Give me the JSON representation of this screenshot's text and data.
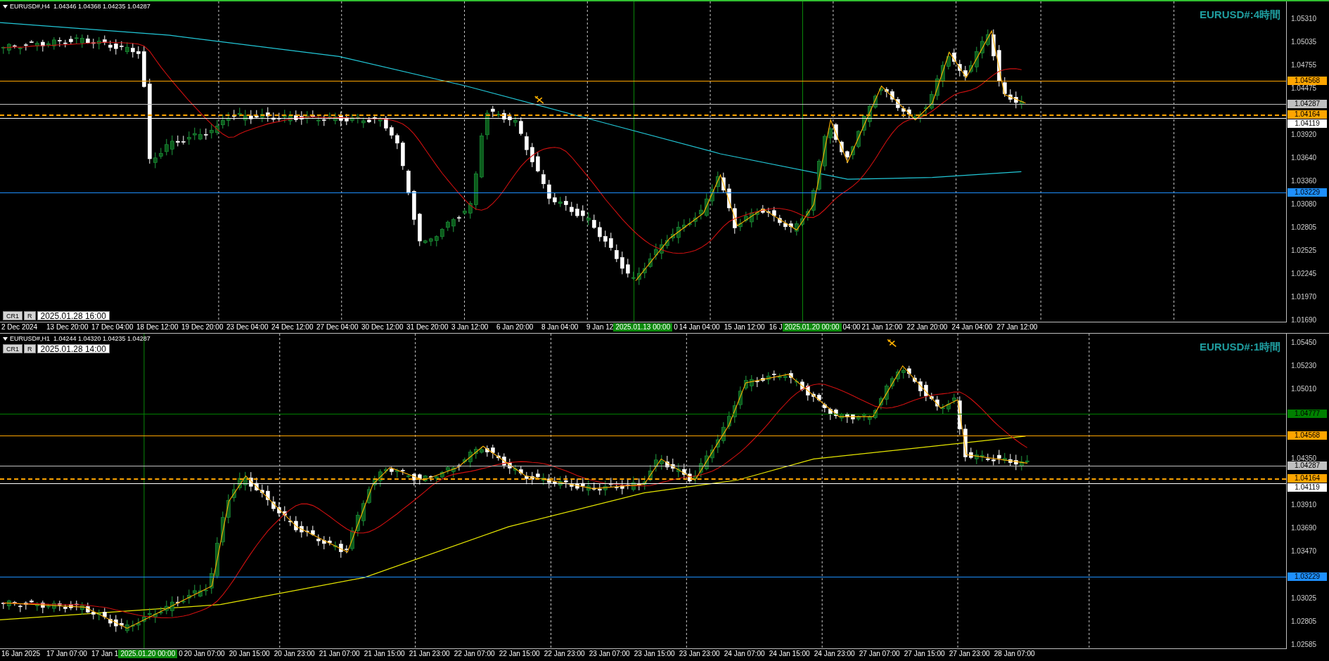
{
  "charts": [
    {
      "header": "EURUSD#,H4  1.04346 1.04368 1.04235 1.04287",
      "title": "EURUSD#:4時間",
      "cursor": {
        "buttons": [
          "CR1",
          "R"
        ],
        "time": "2025.01.28 16:00"
      },
      "price_ticks": [
        "1.05310",
        "1.05035",
        "1.04755",
        "1.04475",
        "1.03920",
        "1.03640",
        "1.03360",
        "1.03080",
        "1.02805",
        "1.02525",
        "1.02245",
        "1.01970",
        "1.01690"
      ],
      "price_lines": [
        {
          "price": "1.04568",
          "color": "#ffa500",
          "dashed": false
        },
        {
          "price": "1.04287",
          "color": "#c0c0c0",
          "dashed": false
        },
        {
          "price": "1.04164",
          "color": "#ffa500",
          "dashed": true
        },
        {
          "price": "1.04119",
          "color": "#ffffff",
          "dashed": false
        },
        {
          "price": "1.03229",
          "color": "#1e90ff",
          "dashed": false
        }
      ],
      "time_axis": [
        {
          "kind": "label",
          "text": "2 Dec 2024"
        },
        {
          "kind": "label",
          "text": "13 Dec 20:00"
        },
        {
          "kind": "label",
          "text": "17 Dec 04:00"
        },
        {
          "kind": "label",
          "text": "18 Dec 12:00"
        },
        {
          "kind": "label",
          "text": "19 Dec 20:00"
        },
        {
          "kind": "label",
          "text": "23 Dec 04:00"
        },
        {
          "kind": "label",
          "text": "24 Dec 12:00"
        },
        {
          "kind": "label",
          "text": "27 Dec 04:00"
        },
        {
          "kind": "label",
          "text": "30 Dec 12:00"
        },
        {
          "kind": "label",
          "text": "31 Dec 20:00"
        },
        {
          "kind": "label",
          "text": "3 Jan 12:00"
        },
        {
          "kind": "label",
          "text": "6 Jan 20:00"
        },
        {
          "kind": "label",
          "text": "8 Jan 04:00"
        },
        {
          "kind": "partial",
          "text": "9 Jan 12"
        },
        {
          "kind": "marker",
          "text": "2025.01.13 00:00"
        },
        {
          "kind": "partial",
          "text": "0"
        },
        {
          "kind": "label",
          "text": "14 Jan 04:00"
        },
        {
          "kind": "label",
          "text": "15 Jan 12:00"
        },
        {
          "kind": "partial",
          "text": "16 J"
        },
        {
          "kind": "marker",
          "text": "2025.01.20 00:00"
        },
        {
          "kind": "partial",
          "text": "04:00"
        },
        {
          "kind": "label",
          "text": "21 Jan 12:00"
        },
        {
          "kind": "label",
          "text": "22 Jan 20:00"
        },
        {
          "kind": "label",
          "text": "24 Jan 04:00"
        },
        {
          "kind": "label",
          "text": "27 Jan 12:00"
        }
      ]
    },
    {
      "header": "EURUSD#,H1  1.04244 1.04320 1.04235 1.04287",
      "title": "EURUSD#:1時間",
      "cursor": {
        "buttons": [
          "CR1",
          "R"
        ],
        "time": "2025.01.28 14:00"
      },
      "price_ticks": [
        "1.05450",
        "1.05230",
        "1.05010",
        "1.04350",
        "1.03910",
        "1.03690",
        "1.03470",
        "1.03025",
        "1.02805",
        "1.02585"
      ],
      "price_lines": [
        {
          "price": "1.04777",
          "color": "#008000",
          "dashed": false
        },
        {
          "price": "1.04568",
          "color": "#ffa500",
          "dashed": false
        },
        {
          "price": "1.04287",
          "color": "#c0c0c0",
          "dashed": false
        },
        {
          "price": "1.04164",
          "color": "#ffa500",
          "dashed": true
        },
        {
          "price": "1.04119",
          "color": "#ffffff",
          "dashed": false
        },
        {
          "price": "1.03229",
          "color": "#1e90ff",
          "dashed": false
        }
      ],
      "time_axis": [
        {
          "kind": "label",
          "text": "16 Jan 2025"
        },
        {
          "kind": "label",
          "text": "17 Jan 07:00"
        },
        {
          "kind": "partial",
          "text": "17 Jan 1"
        },
        {
          "kind": "marker",
          "text": "2025.01.20 00:00"
        },
        {
          "kind": "partial",
          "text": "0"
        },
        {
          "kind": "label",
          "text": "20 Jan 07:00"
        },
        {
          "kind": "label",
          "text": "20 Jan 15:00"
        },
        {
          "kind": "label",
          "text": "20 Jan 23:00"
        },
        {
          "kind": "label",
          "text": "21 Jan 07:00"
        },
        {
          "kind": "label",
          "text": "21 Jan 15:00"
        },
        {
          "kind": "label",
          "text": "21 Jan 23:00"
        },
        {
          "kind": "label",
          "text": "22 Jan 07:00"
        },
        {
          "kind": "label",
          "text": "22 Jan 15:00"
        },
        {
          "kind": "label",
          "text": "22 Jan 23:00"
        },
        {
          "kind": "label",
          "text": "23 Jan 07:00"
        },
        {
          "kind": "label",
          "text": "23 Jan 15:00"
        },
        {
          "kind": "label",
          "text": "23 Jan 23:00"
        },
        {
          "kind": "label",
          "text": "24 Jan 07:00"
        },
        {
          "kind": "label",
          "text": "24 Jan 15:00"
        },
        {
          "kind": "label",
          "text": "24 Jan 23:00"
        },
        {
          "kind": "label",
          "text": "27 Jan 07:00"
        },
        {
          "kind": "label",
          "text": "27 Jan 15:00"
        },
        {
          "kind": "label",
          "text": "27 Jan 23:00"
        },
        {
          "kind": "label",
          "text": "28 Jan 07:00"
        }
      ]
    }
  ]
}
